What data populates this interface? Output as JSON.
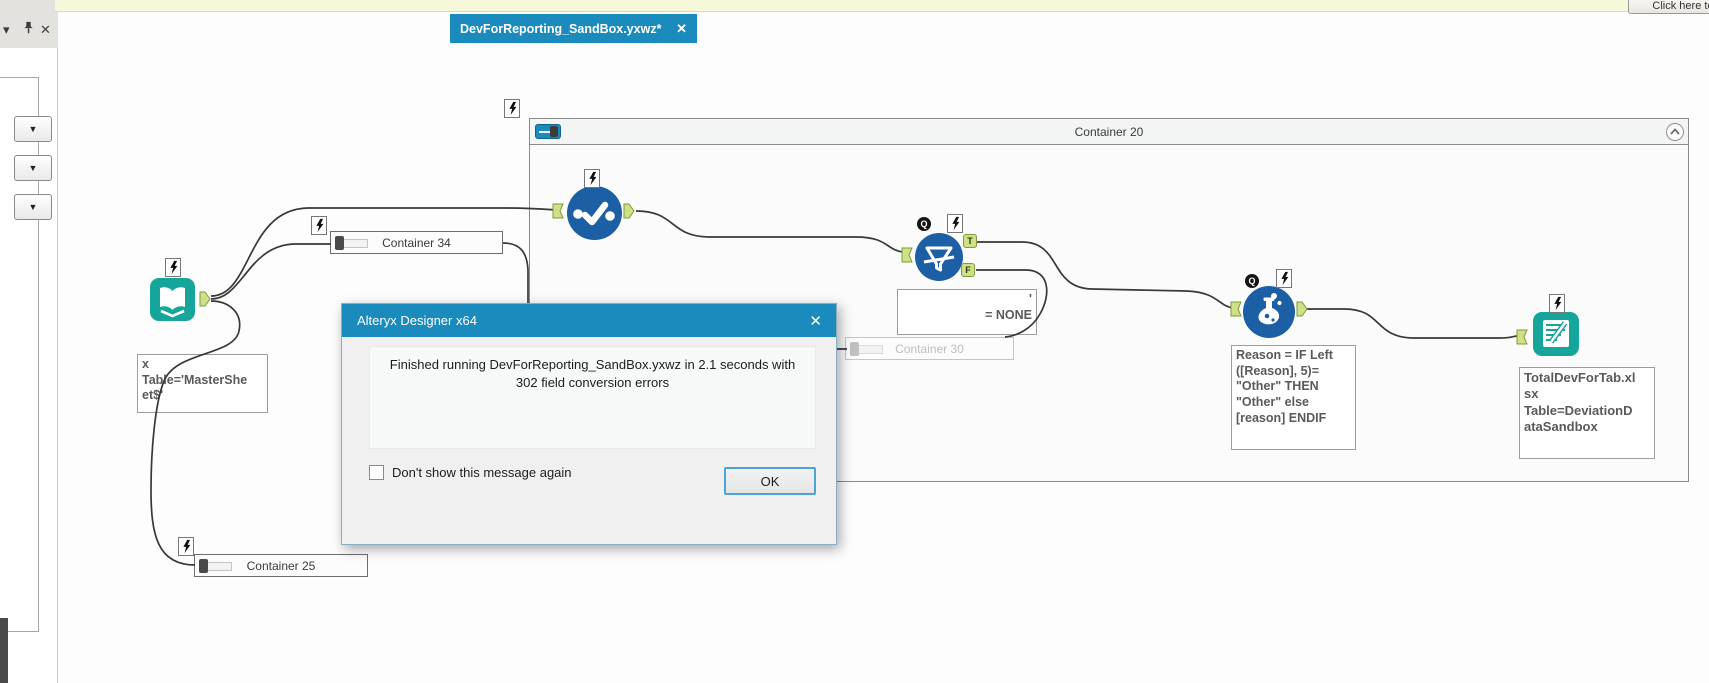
{
  "top": {
    "notify_button": "Click here to"
  },
  "tab": {
    "title": "DevForReporting_SandBox.yxwz*",
    "close_glyph": "✕"
  },
  "left_panel": {
    "collapse_glyph": "▾",
    "close_glyph": "✕",
    "dropdown_glyph": "▼"
  },
  "canvas": {
    "container20_label": "Container 20",
    "container34_label": "Container 34",
    "container30_label": "Container 30",
    "container25_label": "Container 25",
    "q_badge": "Q",
    "t_anchor": "T",
    "f_anchor": "F",
    "notes": {
      "input": "x\nTable='MasterShe\net$'",
      "filter": "'\n= NONE",
      "formula": "Reason = IF Left\n([Reason], 5)=\n\"Other\" THEN\n\"Other\" else\n[reason] ENDIF",
      "output": "TotalDevForTab.xl\nsx\nTable=DeviationD\nataSandbox"
    }
  },
  "dialog": {
    "title": "Alteryx Designer x64",
    "close_glyph": "✕",
    "message": "Finished running DevForReporting_SandBox.yxwz in 2.1 seconds with 302 field conversion errors",
    "checkbox_label": "Don't show this message again",
    "ok_label": "OK"
  },
  "colors": {
    "accent_blue": "#1a8bbc",
    "tool_blue": "#1d5fa4",
    "teal": "#16a59a",
    "anchor_green": "#cfe087",
    "wire": "#383838"
  }
}
